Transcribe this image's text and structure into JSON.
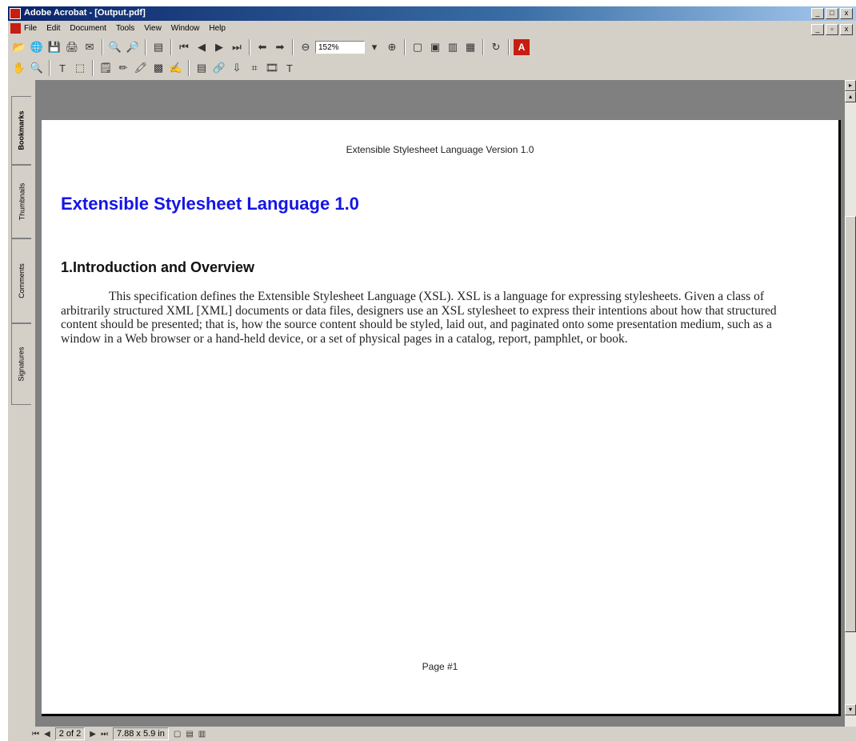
{
  "window": {
    "title": "Adobe Acrobat - [Output.pdf]",
    "controls": [
      "_",
      "□",
      "x"
    ],
    "mdi_controls": [
      "_",
      "▫",
      "x"
    ]
  },
  "menu": [
    "File",
    "Edit",
    "Document",
    "Tools",
    "View",
    "Window",
    "Help"
  ],
  "toolbar": {
    "zoom_value": "152%"
  },
  "sidebar_tabs": [
    "Bookmarks",
    "Thumbnails",
    "Comments",
    "Signatures"
  ],
  "document": {
    "header": "Extensible Stylesheet Language Version 1.0",
    "title": "Extensible Stylesheet Language 1.0",
    "section_heading": "1.Introduction and Overview",
    "body": "This specification defines the Extensible Stylesheet Language (XSL). XSL is a language for expressing stylesheets. Given a class of arbitrarily structured XML [XML] documents or data files, designers use an XSL stylesheet to express their intentions about how that structured content should be presented; that is, how the source content should be styled, laid out, and paginated onto some presentation medium, such as a window in a Web browser or a hand-held device, or a set of physical pages in a catalog, report, pamphlet, or book.",
    "footer": "Page #1"
  },
  "status": {
    "page_indicator": "2 of 2",
    "page_size": "7.88 x 5.9 in"
  },
  "colors": {
    "title_blue": "#1515e6",
    "acrobat_red": "#c81d11"
  }
}
